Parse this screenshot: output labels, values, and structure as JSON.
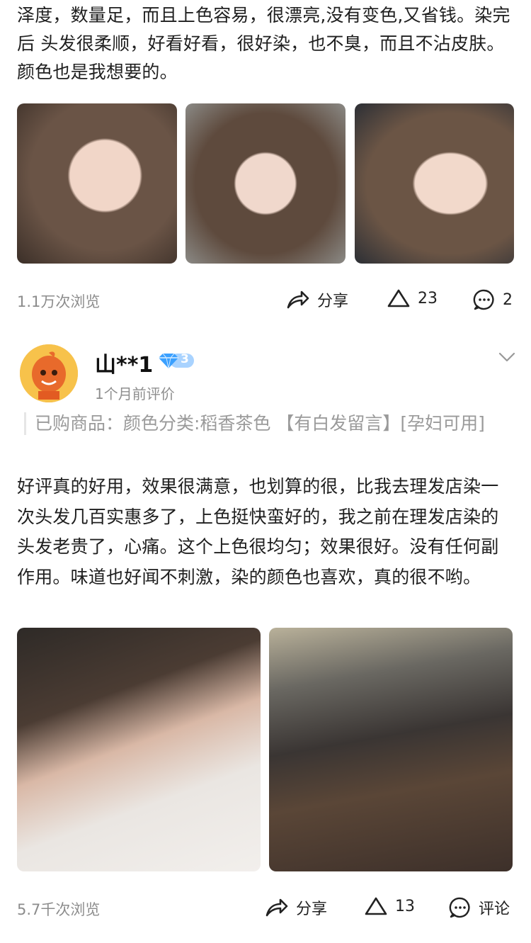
{
  "post1": {
    "text": "泽度，数量足，而且上色容易，很漂亮,没有变色,又省钱。染完后 头发很柔顺，好看好看，很好染，也不臭，而且不沾皮肤。颜色也是我想要的。",
    "views": "1.1万次浏览",
    "share_label": "分享",
    "like_count": "23",
    "comment_count": "2"
  },
  "review2": {
    "username": "山**1",
    "level": "3",
    "time": "1个月前评价",
    "purchase": "已购商品：颜色分类:稻香茶色 【有白发留言】[孕妇可用]",
    "text": "好评真的好用，效果很满意，也划算的很，比我去理发店染一次头发几百实惠多了，上色挺快蛮好的，我之前在理发店染的头发老贵了，心痛。这个上色很均匀；效果很好。没有任何副作用。味道也好闻不刺激，染的颜色也喜欢，真的很不哟。",
    "views": "5.7千次浏览",
    "share_label": "分享",
    "like_count": "13",
    "comment_label": "评论"
  },
  "colors": {
    "accent_level": "#3aa0ff",
    "muted": "#8c8c8c"
  },
  "icons": [
    "share-icon",
    "like-icon",
    "comment-icon",
    "chevron-down-icon",
    "level-badge-icon"
  ]
}
